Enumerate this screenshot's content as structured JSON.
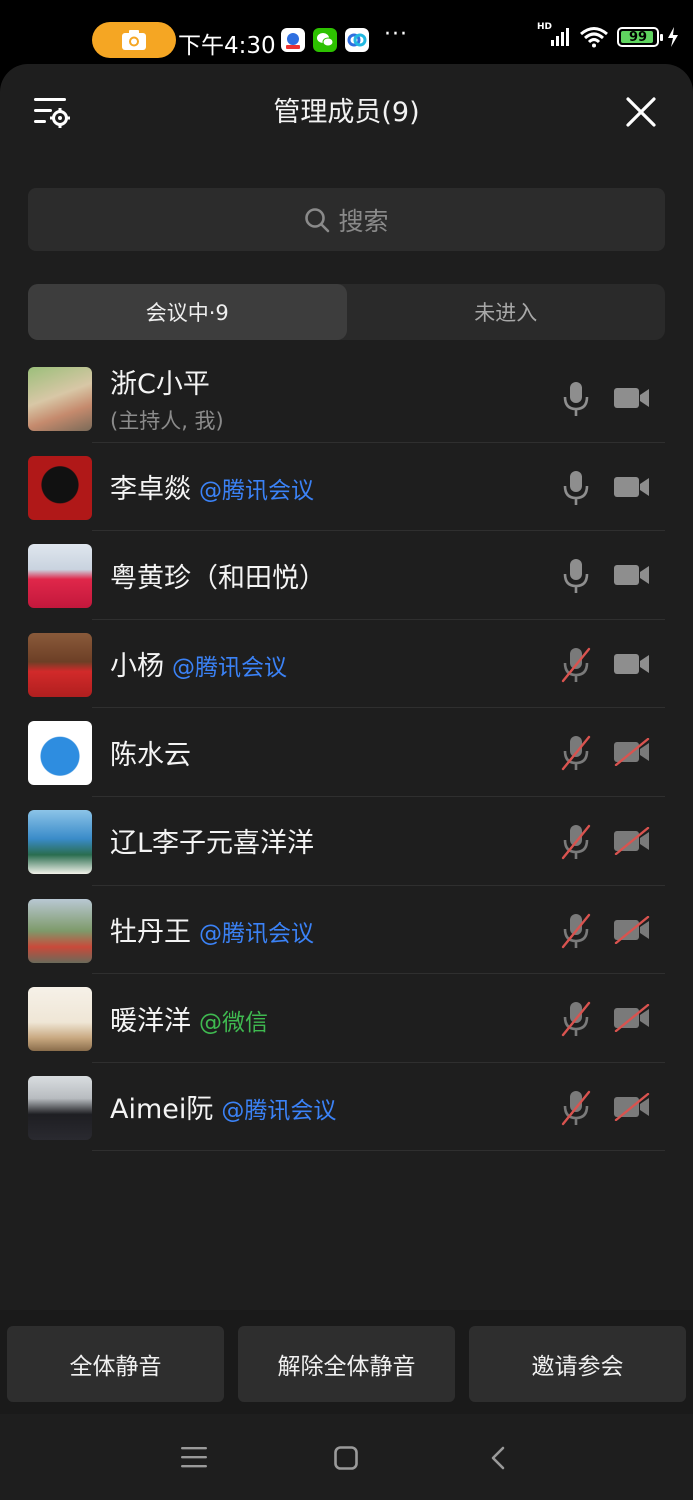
{
  "status_bar": {
    "time": "下午4:30",
    "more": "···",
    "network": "HD",
    "battery": "99"
  },
  "header": {
    "title": "管理成员(9)"
  },
  "search": {
    "placeholder": "搜索"
  },
  "tabs": [
    {
      "label": "会议中·9",
      "active": true
    },
    {
      "label": "未进入",
      "active": false
    }
  ],
  "members": [
    {
      "name": "浙C小平",
      "tag": "",
      "tag_color": "",
      "sub": "(主持人, 我)",
      "mic": "on",
      "camera": "on"
    },
    {
      "name": "李卓燚",
      "tag": "@腾讯会议",
      "tag_color": "blue",
      "sub": "",
      "mic": "on",
      "camera": "on"
    },
    {
      "name": "粤黄珍（和田悦）",
      "tag": "",
      "tag_color": "",
      "sub": "",
      "mic": "on",
      "camera": "on"
    },
    {
      "name": "小杨",
      "tag": "@腾讯会议",
      "tag_color": "blue",
      "sub": "",
      "mic": "off",
      "camera": "on"
    },
    {
      "name": "陈水云",
      "tag": "",
      "tag_color": "",
      "sub": "",
      "mic": "off",
      "camera": "off"
    },
    {
      "name": "辽L李子元喜洋洋",
      "tag": "",
      "tag_color": "",
      "sub": "",
      "mic": "off",
      "camera": "off"
    },
    {
      "name": "牡丹王",
      "tag": "@腾讯会议",
      "tag_color": "blue",
      "sub": "",
      "mic": "off",
      "camera": "off"
    },
    {
      "name": "暖洋洋",
      "tag": "@微信",
      "tag_color": "green",
      "sub": "",
      "mic": "off",
      "camera": "off"
    },
    {
      "name": "Aimei阮",
      "tag": "@腾讯会议",
      "tag_color": "blue",
      "sub": "",
      "mic": "off",
      "camera": "off"
    }
  ],
  "actions": {
    "mute_all": "全体静音",
    "unmute_all": "解除全体静音",
    "invite": "邀请参会"
  },
  "colors": {
    "accent_blue": "#3b82f6",
    "wechat_green": "#3fb950",
    "muted_red": "#d9534f",
    "sheet_bg": "#1e1e1e"
  }
}
